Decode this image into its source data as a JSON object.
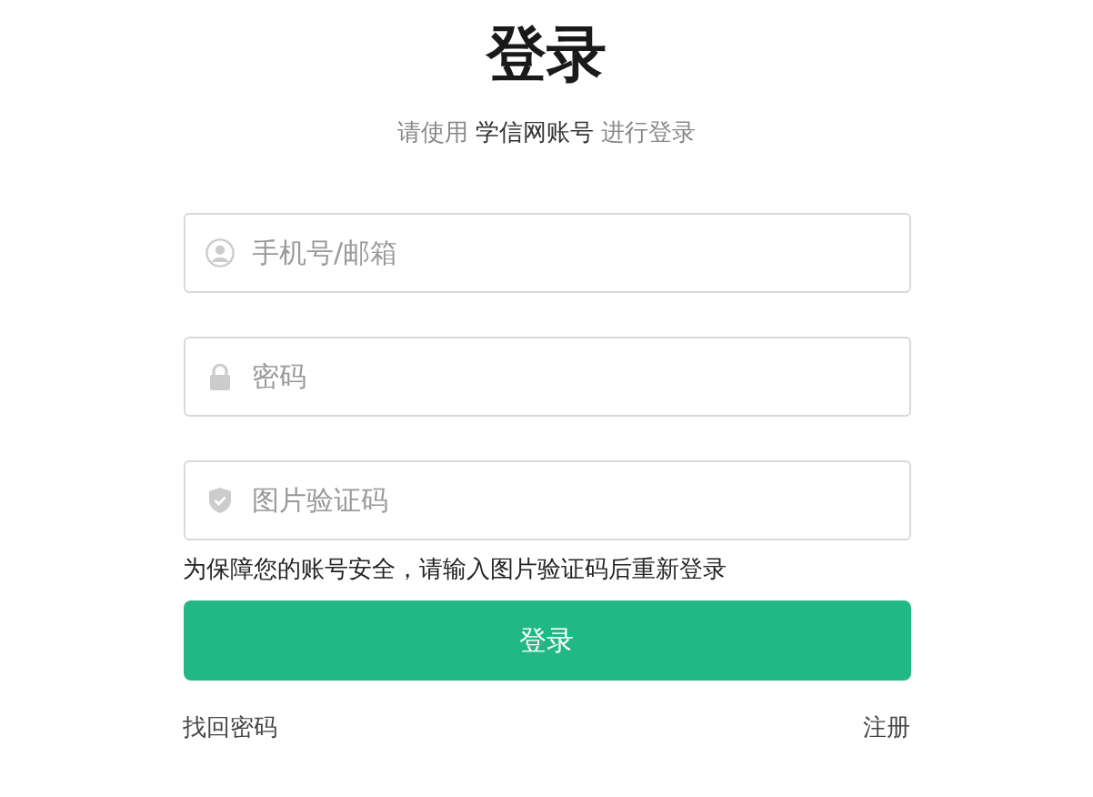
{
  "title": "登录",
  "subtitle": {
    "before": "请使用",
    "highlight": "学信网账号",
    "after": "进行登录"
  },
  "fields": [
    {
      "kind": "user",
      "placeholder": "手机号/邮箱"
    },
    {
      "kind": "lock",
      "placeholder": "密码"
    },
    {
      "kind": "shield",
      "placeholder": "图片验证码"
    }
  ],
  "notice": "为保障您的账号安全，请输入图片验证码后重新登录",
  "submit": "登录",
  "links": {
    "left": "找回密码",
    "right": "注册"
  }
}
